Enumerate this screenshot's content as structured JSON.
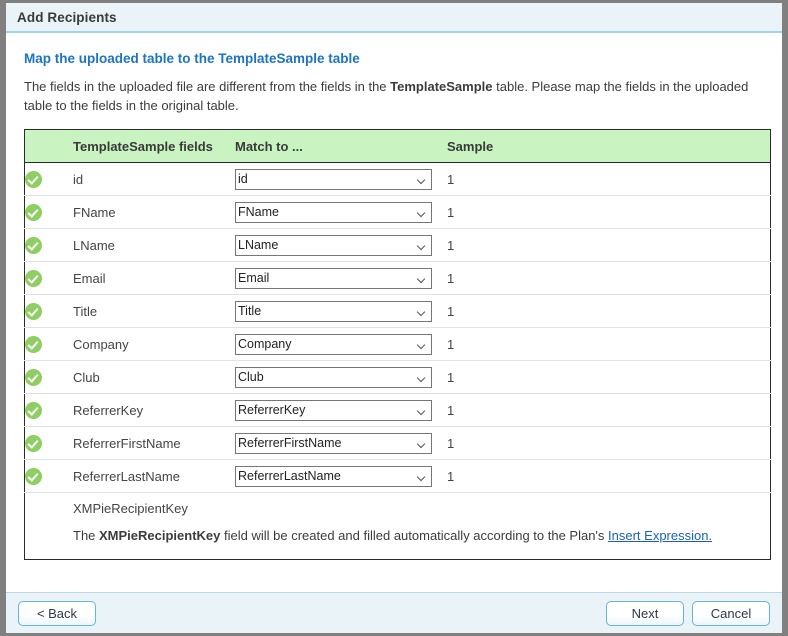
{
  "window": {
    "title": "Add Recipients"
  },
  "content": {
    "heading": "Map the uploaded table to the TemplateSample table",
    "intro_part1": "The fields in the uploaded file are different from the fields in the ",
    "intro_bold": "TemplateSample",
    "intro_part2": " table. Please map the fields in the uploaded table to the fields in the original table."
  },
  "table": {
    "headers": {
      "icon": "",
      "field": "TemplateSample fields",
      "match": "Match to ...",
      "sample": "Sample"
    },
    "rows": [
      {
        "status_icon": "check-circle-icon",
        "field": "id",
        "match": "id",
        "sample": "1"
      },
      {
        "status_icon": "check-circle-icon",
        "field": "FName",
        "match": "FName",
        "sample": "1"
      },
      {
        "status_icon": "check-circle-icon",
        "field": "LName",
        "match": "LName",
        "sample": "1"
      },
      {
        "status_icon": "check-circle-icon",
        "field": "Email",
        "match": "Email",
        "sample": "1"
      },
      {
        "status_icon": "check-circle-icon",
        "field": "Title",
        "match": "Title",
        "sample": "1"
      },
      {
        "status_icon": "check-circle-icon",
        "field": "Company",
        "match": "Company",
        "sample": "1"
      },
      {
        "status_icon": "check-circle-icon",
        "field": "Club",
        "match": "Club",
        "sample": "1"
      },
      {
        "status_icon": "check-circle-icon",
        "field": "ReferrerKey",
        "match": "ReferrerKey",
        "sample": "1"
      },
      {
        "status_icon": "check-circle-icon",
        "field": "ReferrerFirstName",
        "match": "ReferrerFirstName",
        "sample": "1"
      },
      {
        "status_icon": "check-circle-icon",
        "field": "ReferrerLastName",
        "match": "ReferrerLastName",
        "sample": "1"
      }
    ],
    "note": {
      "key_label": "XMPieRecipientKey",
      "text_part1": "The ",
      "text_bold": "XMPieRecipientKey",
      "text_part2": " field will be created and filled automatically according to the Plan's ",
      "link": "Insert Expression."
    }
  },
  "footer": {
    "back_label": "< Back",
    "next_label": "Next",
    "cancel_label": "Cancel"
  },
  "colors": {
    "titlebar_bg": "#e9f3f8",
    "titlebar_rule": "#9fd4e3",
    "heading_blue": "#1b74c4",
    "table_header_green": "#c9f3c0",
    "check_green": "#8fce62",
    "link_blue": "#1b5fbe",
    "button_border": "#63b6d4",
    "page_bg": "#808080"
  }
}
